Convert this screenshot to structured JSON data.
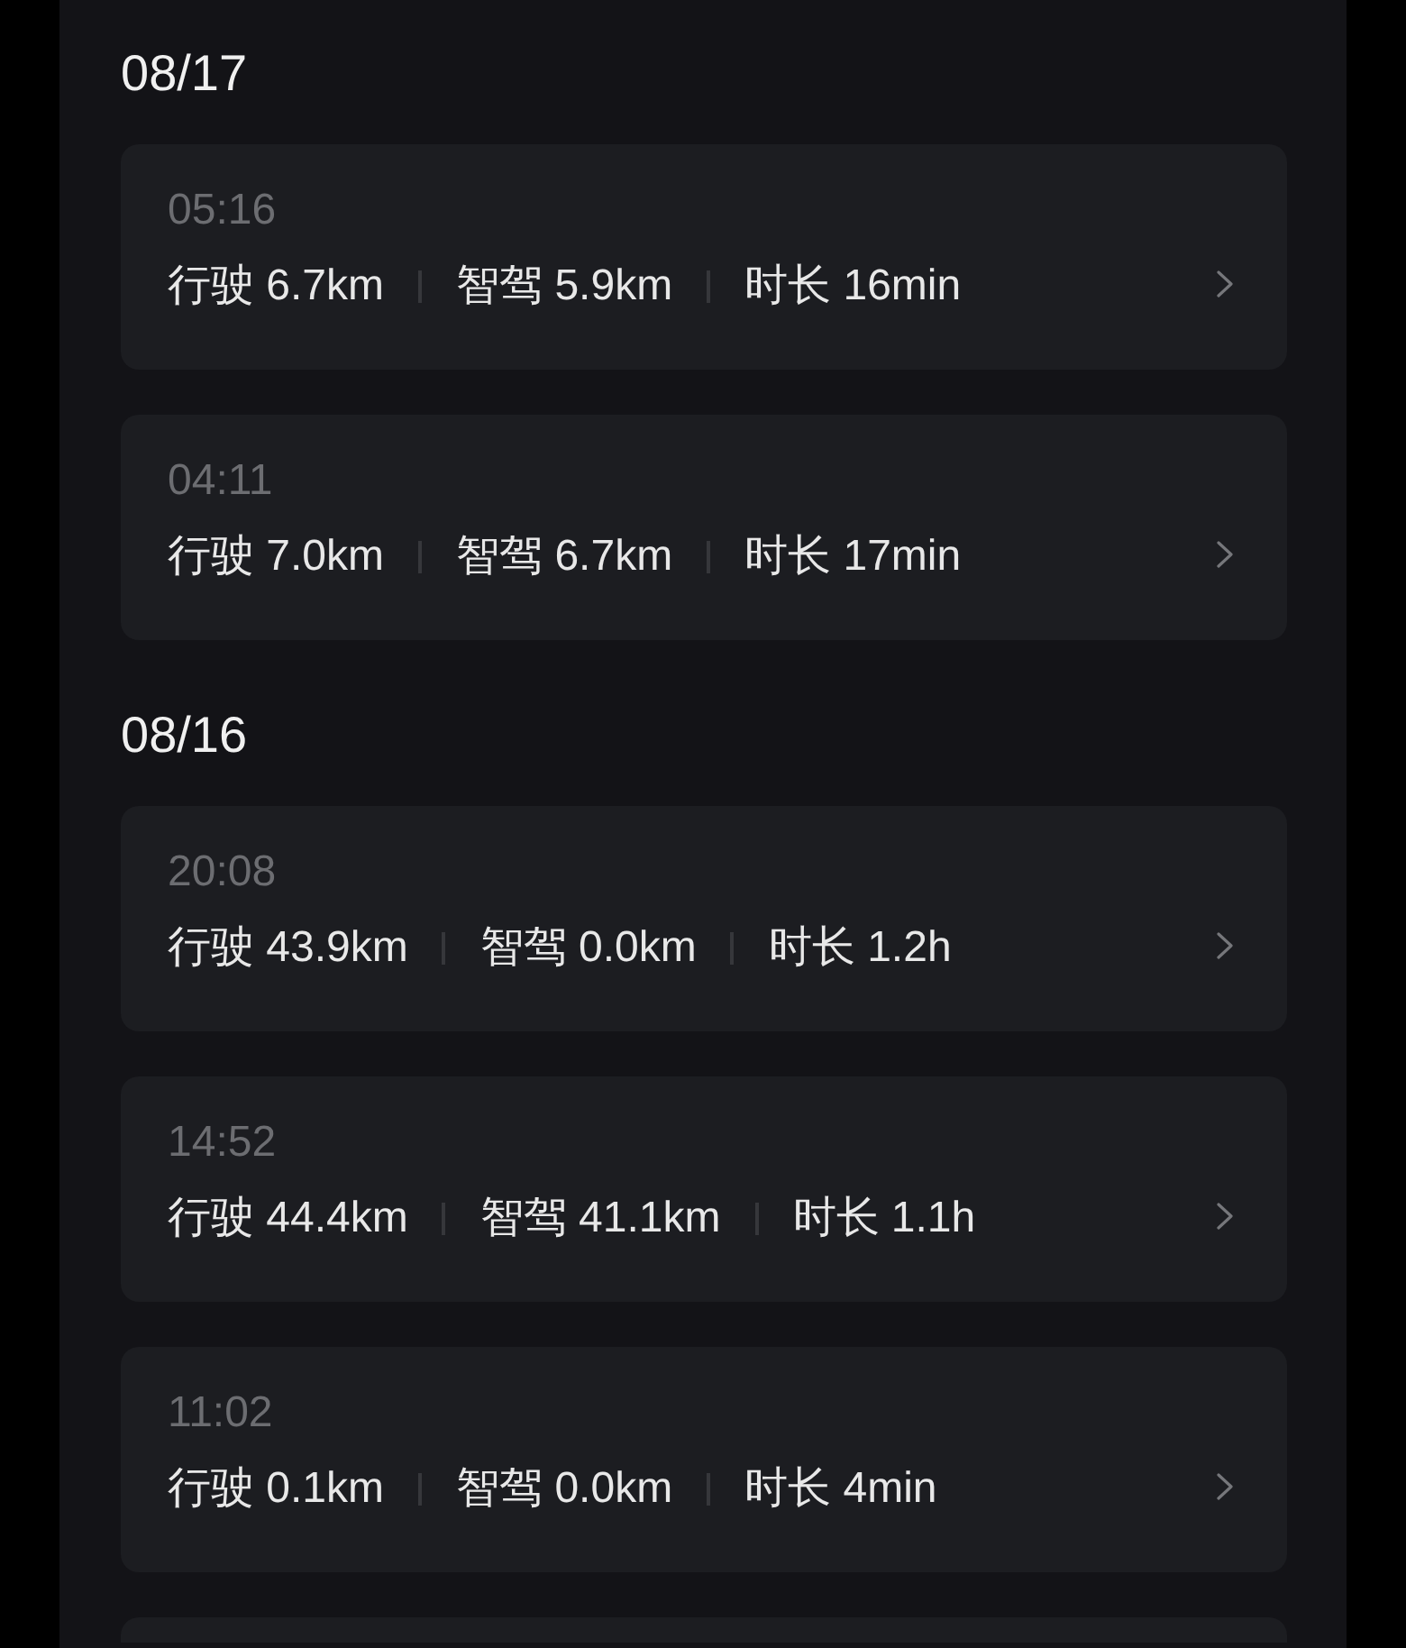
{
  "groups": [
    {
      "date": "08/17",
      "trips": [
        {
          "time": "05:16",
          "stats": [
            "行驶 6.7km",
            "智驾 5.9km",
            "时长 16min"
          ]
        },
        {
          "time": "04:11",
          "stats": [
            "行驶 7.0km",
            "智驾 6.7km",
            "时长 17min"
          ]
        }
      ]
    },
    {
      "date": "08/16",
      "trips": [
        {
          "time": "20:08",
          "stats": [
            "行驶 43.9km",
            "智驾 0.0km",
            "时长 1.2h"
          ]
        },
        {
          "time": "14:52",
          "stats": [
            "行驶 44.4km",
            "智驾 41.1km",
            "时长 1.1h"
          ]
        },
        {
          "time": "11:02",
          "stats": [
            "行驶 0.1km",
            "智驾 0.0km",
            "时长 4min"
          ]
        }
      ]
    }
  ]
}
